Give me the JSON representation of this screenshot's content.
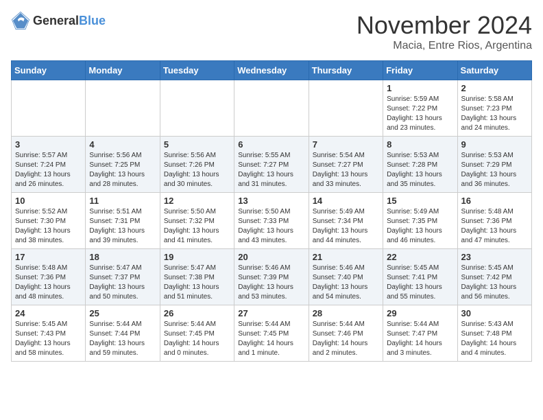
{
  "header": {
    "logo": {
      "text_general": "General",
      "text_blue": "Blue"
    },
    "month": "November 2024",
    "location": "Macia, Entre Rios, Argentina"
  },
  "days_of_week": [
    "Sunday",
    "Monday",
    "Tuesday",
    "Wednesday",
    "Thursday",
    "Friday",
    "Saturday"
  ],
  "weeks": [
    [
      {
        "day": "",
        "sunrise": "",
        "sunset": "",
        "daylight": ""
      },
      {
        "day": "",
        "sunrise": "",
        "sunset": "",
        "daylight": ""
      },
      {
        "day": "",
        "sunrise": "",
        "sunset": "",
        "daylight": ""
      },
      {
        "day": "",
        "sunrise": "",
        "sunset": "",
        "daylight": ""
      },
      {
        "day": "",
        "sunrise": "",
        "sunset": "",
        "daylight": ""
      },
      {
        "day": "1",
        "sunrise": "Sunrise: 5:59 AM",
        "sunset": "Sunset: 7:22 PM",
        "daylight": "Daylight: 13 hours and 23 minutes."
      },
      {
        "day": "2",
        "sunrise": "Sunrise: 5:58 AM",
        "sunset": "Sunset: 7:23 PM",
        "daylight": "Daylight: 13 hours and 24 minutes."
      }
    ],
    [
      {
        "day": "3",
        "sunrise": "Sunrise: 5:57 AM",
        "sunset": "Sunset: 7:24 PM",
        "daylight": "Daylight: 13 hours and 26 minutes."
      },
      {
        "day": "4",
        "sunrise": "Sunrise: 5:56 AM",
        "sunset": "Sunset: 7:25 PM",
        "daylight": "Daylight: 13 hours and 28 minutes."
      },
      {
        "day": "5",
        "sunrise": "Sunrise: 5:56 AM",
        "sunset": "Sunset: 7:26 PM",
        "daylight": "Daylight: 13 hours and 30 minutes."
      },
      {
        "day": "6",
        "sunrise": "Sunrise: 5:55 AM",
        "sunset": "Sunset: 7:27 PM",
        "daylight": "Daylight: 13 hours and 31 minutes."
      },
      {
        "day": "7",
        "sunrise": "Sunrise: 5:54 AM",
        "sunset": "Sunset: 7:27 PM",
        "daylight": "Daylight: 13 hours and 33 minutes."
      },
      {
        "day": "8",
        "sunrise": "Sunrise: 5:53 AM",
        "sunset": "Sunset: 7:28 PM",
        "daylight": "Daylight: 13 hours and 35 minutes."
      },
      {
        "day": "9",
        "sunrise": "Sunrise: 5:53 AM",
        "sunset": "Sunset: 7:29 PM",
        "daylight": "Daylight: 13 hours and 36 minutes."
      }
    ],
    [
      {
        "day": "10",
        "sunrise": "Sunrise: 5:52 AM",
        "sunset": "Sunset: 7:30 PM",
        "daylight": "Daylight: 13 hours and 38 minutes."
      },
      {
        "day": "11",
        "sunrise": "Sunrise: 5:51 AM",
        "sunset": "Sunset: 7:31 PM",
        "daylight": "Daylight: 13 hours and 39 minutes."
      },
      {
        "day": "12",
        "sunrise": "Sunrise: 5:50 AM",
        "sunset": "Sunset: 7:32 PM",
        "daylight": "Daylight: 13 hours and 41 minutes."
      },
      {
        "day": "13",
        "sunrise": "Sunrise: 5:50 AM",
        "sunset": "Sunset: 7:33 PM",
        "daylight": "Daylight: 13 hours and 43 minutes."
      },
      {
        "day": "14",
        "sunrise": "Sunrise: 5:49 AM",
        "sunset": "Sunset: 7:34 PM",
        "daylight": "Daylight: 13 hours and 44 minutes."
      },
      {
        "day": "15",
        "sunrise": "Sunrise: 5:49 AM",
        "sunset": "Sunset: 7:35 PM",
        "daylight": "Daylight: 13 hours and 46 minutes."
      },
      {
        "day": "16",
        "sunrise": "Sunrise: 5:48 AM",
        "sunset": "Sunset: 7:36 PM",
        "daylight": "Daylight: 13 hours and 47 minutes."
      }
    ],
    [
      {
        "day": "17",
        "sunrise": "Sunrise: 5:48 AM",
        "sunset": "Sunset: 7:36 PM",
        "daylight": "Daylight: 13 hours and 48 minutes."
      },
      {
        "day": "18",
        "sunrise": "Sunrise: 5:47 AM",
        "sunset": "Sunset: 7:37 PM",
        "daylight": "Daylight: 13 hours and 50 minutes."
      },
      {
        "day": "19",
        "sunrise": "Sunrise: 5:47 AM",
        "sunset": "Sunset: 7:38 PM",
        "daylight": "Daylight: 13 hours and 51 minutes."
      },
      {
        "day": "20",
        "sunrise": "Sunrise: 5:46 AM",
        "sunset": "Sunset: 7:39 PM",
        "daylight": "Daylight: 13 hours and 53 minutes."
      },
      {
        "day": "21",
        "sunrise": "Sunrise: 5:46 AM",
        "sunset": "Sunset: 7:40 PM",
        "daylight": "Daylight: 13 hours and 54 minutes."
      },
      {
        "day": "22",
        "sunrise": "Sunrise: 5:45 AM",
        "sunset": "Sunset: 7:41 PM",
        "daylight": "Daylight: 13 hours and 55 minutes."
      },
      {
        "day": "23",
        "sunrise": "Sunrise: 5:45 AM",
        "sunset": "Sunset: 7:42 PM",
        "daylight": "Daylight: 13 hours and 56 minutes."
      }
    ],
    [
      {
        "day": "24",
        "sunrise": "Sunrise: 5:45 AM",
        "sunset": "Sunset: 7:43 PM",
        "daylight": "Daylight: 13 hours and 58 minutes."
      },
      {
        "day": "25",
        "sunrise": "Sunrise: 5:44 AM",
        "sunset": "Sunset: 7:44 PM",
        "daylight": "Daylight: 13 hours and 59 minutes."
      },
      {
        "day": "26",
        "sunrise": "Sunrise: 5:44 AM",
        "sunset": "Sunset: 7:45 PM",
        "daylight": "Daylight: 14 hours and 0 minutes."
      },
      {
        "day": "27",
        "sunrise": "Sunrise: 5:44 AM",
        "sunset": "Sunset: 7:45 PM",
        "daylight": "Daylight: 14 hours and 1 minute."
      },
      {
        "day": "28",
        "sunrise": "Sunrise: 5:44 AM",
        "sunset": "Sunset: 7:46 PM",
        "daylight": "Daylight: 14 hours and 2 minutes."
      },
      {
        "day": "29",
        "sunrise": "Sunrise: 5:44 AM",
        "sunset": "Sunset: 7:47 PM",
        "daylight": "Daylight: 14 hours and 3 minutes."
      },
      {
        "day": "30",
        "sunrise": "Sunrise: 5:43 AM",
        "sunset": "Sunset: 7:48 PM",
        "daylight": "Daylight: 14 hours and 4 minutes."
      }
    ]
  ]
}
